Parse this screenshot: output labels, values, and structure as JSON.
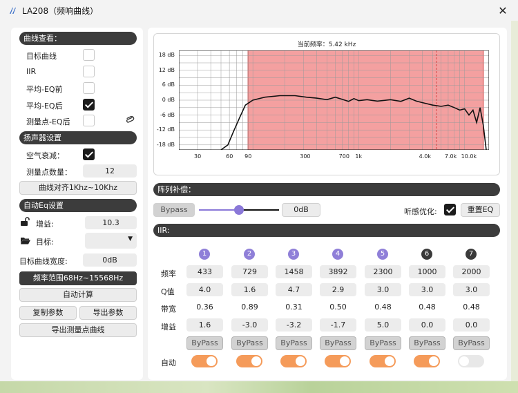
{
  "window": {
    "title": "LA208（频响曲线）",
    "close": "✕"
  },
  "curve_view": {
    "header": "曲线查看：",
    "items": [
      {
        "label": "目标曲线",
        "checked": false
      },
      {
        "label": "IIR",
        "checked": false
      },
      {
        "label": "平均-EQ前",
        "checked": false
      },
      {
        "label": "平均-EQ后",
        "checked": true
      },
      {
        "label": "测量点-EQ后",
        "checked": false
      }
    ]
  },
  "speaker": {
    "header": "扬声器设置",
    "air_label": "空气衰减：",
    "air_checked": true,
    "points_label": "测量点数量：",
    "points_value": "12",
    "align_button": "曲线对齐1Khz~10Khz"
  },
  "auto_eq": {
    "header": "自动Eq设置",
    "gain_label": "增益:",
    "gain_value": "10.3",
    "target_label": "目标:",
    "target_value": "",
    "width_label": "目标曲线宽度:",
    "width_value": "0dB",
    "range_button": "频率范围68Hz~15568Hz",
    "calc_button": "自动计算",
    "copy_button": "复制参数",
    "export_button": "导出参数",
    "export_curve_button": "导出测量点曲线"
  },
  "chart": {
    "title": "当前频率：5.42 kHz",
    "band_color": "#f4a0a0",
    "line_color": "#111111"
  },
  "chart_data": {
    "type": "line",
    "title": "当前频率：5.42 kHz",
    "xscale": "log",
    "xlim": [
      20,
      17000
    ],
    "ylim": [
      -20,
      20
    ],
    "y_ticks": [
      "18 dB",
      "12 dB",
      "6 dB",
      "0 dB",
      "-6 dB",
      "-12 dB",
      "-18 dB"
    ],
    "x_ticks": [
      "30",
      "60",
      "90",
      "300",
      "700",
      "1k",
      "4.0k",
      "7.0k",
      "10.0k"
    ],
    "band": [
      90,
      15000
    ],
    "cursor_x": 5420,
    "grid": true,
    "series": [
      {
        "x": [
          50,
          58,
          65,
          75,
          85,
          100,
          130,
          180,
          250,
          320,
          400,
          500,
          600,
          700,
          800,
          900,
          1000,
          1200,
          1500,
          2000,
          2500,
          3000,
          3500,
          4000,
          5000,
          6000,
          7000,
          8000,
          9000,
          10000,
          11000,
          12000,
          13000,
          14000,
          15000,
          16000
        ],
        "y": [
          -20,
          -18,
          -13,
          -7,
          -2,
          0,
          1.2,
          1.8,
          1.8,
          1.2,
          0.8,
          0.2,
          1.2,
          0.3,
          -0.5,
          0.6,
          -0.2,
          0.2,
          -0.4,
          0.2,
          -0.5,
          0.8,
          -0.4,
          -1,
          -2,
          -2.5,
          -2,
          -3,
          -4,
          -3.5,
          -6,
          -4,
          -9,
          -3,
          -10,
          -20
        ]
      }
    ]
  },
  "array_comp": {
    "header": "阵列补偿：",
    "bypass_label": "Bypass",
    "slider_value": 0.5,
    "db_value": "0dB",
    "optimize_label": "听感优化:",
    "optimize_checked": true,
    "reset_button": "重置EQ"
  },
  "iir": {
    "header": "IIR:",
    "row_labels": {
      "freq": "频率",
      "q": "Q值",
      "bw": "带宽",
      "gain": "增益",
      "auto": "自动"
    },
    "bypass_label": "ByPass",
    "bands": [
      {
        "num": "1",
        "freq": "433",
        "q": "4.0",
        "bw": "0.36",
        "gain": "1.6",
        "auto": true,
        "dark": false
      },
      {
        "num": "2",
        "freq": "729",
        "q": "1.6",
        "bw": "0.89",
        "gain": "-3.0",
        "auto": true,
        "dark": false
      },
      {
        "num": "3",
        "freq": "1458",
        "q": "4.7",
        "bw": "0.31",
        "gain": "-3.2",
        "auto": true,
        "dark": false
      },
      {
        "num": "4",
        "freq": "3892",
        "q": "2.9",
        "bw": "0.50",
        "gain": "-1.7",
        "auto": true,
        "dark": false
      },
      {
        "num": "5",
        "freq": "2300",
        "q": "3.0",
        "bw": "0.48",
        "gain": "5.0",
        "auto": true,
        "dark": false
      },
      {
        "num": "6",
        "freq": "1000",
        "q": "3.0",
        "bw": "0.48",
        "gain": "0.0",
        "auto": true,
        "dark": true
      },
      {
        "num": "7",
        "freq": "2000",
        "q": "3.0",
        "bw": "0.48",
        "gain": "0.0",
        "auto": false,
        "dark": true
      }
    ]
  }
}
